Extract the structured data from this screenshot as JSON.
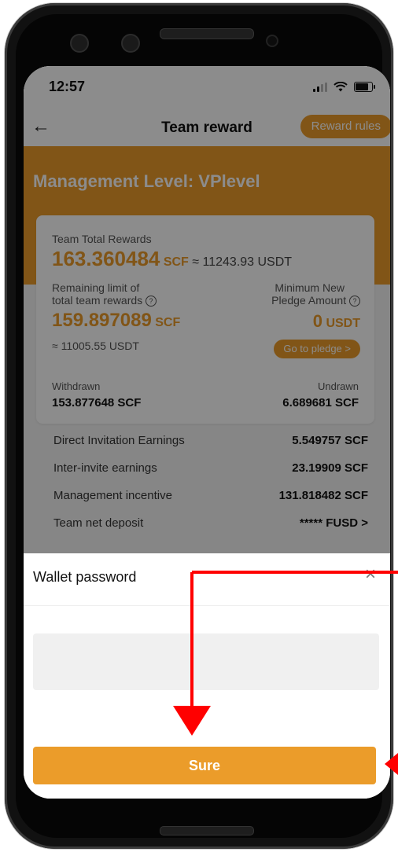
{
  "status_bar": {
    "time": "12:57"
  },
  "header": {
    "title": "Team reward",
    "rules_button": "Reward rules"
  },
  "banner": {
    "level_text": "Management Level: VPlevel"
  },
  "card": {
    "total_label": "Team Total Rewards",
    "total_value": "163.360484",
    "total_unit": "SCF",
    "total_approx": "≈ 11243.93 USDT",
    "remaining_label_line1": "Remaining limit of",
    "remaining_label_line2": "total team rewards",
    "remaining_value": "159.897089",
    "remaining_unit": "SCF",
    "remaining_approx": "≈ 11005.55 USDT",
    "min_pledge_label_line1": "Minimum New",
    "min_pledge_label_line2": "Pledge Amount",
    "min_pledge_value": "0",
    "min_pledge_unit": "USDT",
    "go_pledge_button": "Go to pledge >",
    "withdrawn_label": "Withdrawn",
    "withdrawn_value": "153.877648 SCF",
    "undrawn_label": "Undrawn",
    "undrawn_value": "6.689681 SCF"
  },
  "earnings": [
    {
      "label": "Direct Invitation Earnings",
      "value": "5.549757 SCF"
    },
    {
      "label": "Inter-invite earnings",
      "value": "23.19909 SCF"
    },
    {
      "label": "Management incentive",
      "value": "131.818482 SCF"
    },
    {
      "label": "Team net deposit",
      "value": "***** FUSD >"
    }
  ],
  "dialog": {
    "title": "Wallet password",
    "close_icon": "close-icon",
    "password_value": "",
    "submit_button": "Sure"
  },
  "colors": {
    "accent": "#eb9c2a",
    "annotation": "#ff0000"
  }
}
